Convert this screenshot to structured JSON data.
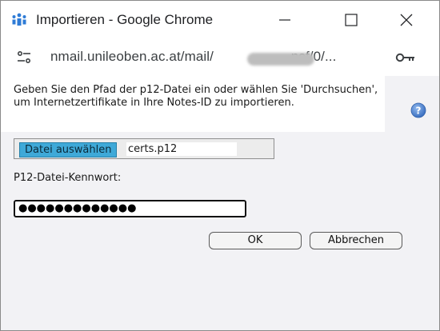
{
  "window": {
    "title": "Importieren - Google Chrome"
  },
  "urlbar": {
    "url_prefix": "nmail.unileoben.ac.at/mail/",
    "url_suffix": ".nsf/0/..."
  },
  "dialog": {
    "instructions": "Geben Sie den Pfad der p12-Datei ein oder wählen Sie 'Durchsuchen', um Internetzertifikate in Ihre Notes-ID zu importieren.",
    "file_button_label": "Datei auswählen",
    "file_name": "certs.p12",
    "password_label": "P12-Datei-Kennwort:",
    "password_value": "●●●●●●●●●●●●●",
    "ok_label": "OK",
    "cancel_label": "Abbrechen"
  },
  "colors": {
    "file_button": "#3fa9d8",
    "help_icon": "#4a7fc8",
    "content_bg": "#f2f2f5"
  },
  "icons": [
    "app-people-icon",
    "site-settings-icon",
    "key-icon",
    "help-icon",
    "minimize-icon",
    "maximize-icon",
    "close-icon"
  ]
}
